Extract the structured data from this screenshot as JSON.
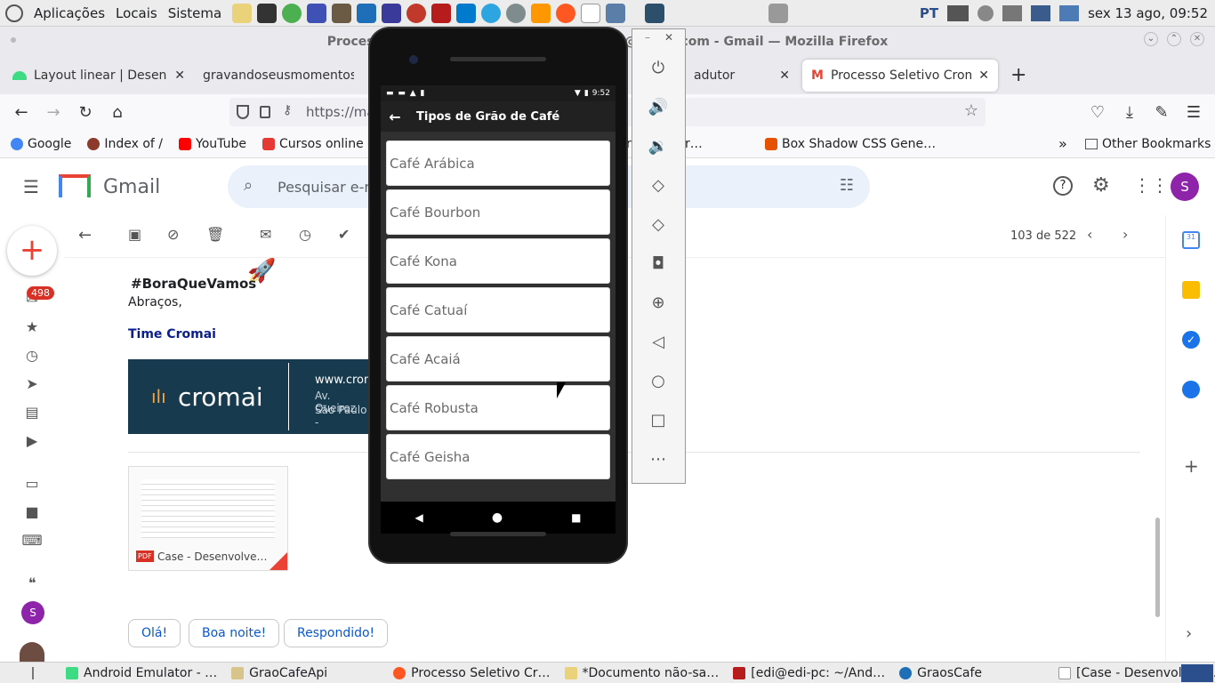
{
  "os_panel": {
    "menus": [
      "Aplicações",
      "Locais",
      "Sistema"
    ],
    "language": "PT",
    "clock": "sex 13 ago, 09:52"
  },
  "firefox": {
    "window_title": "Processo Seletivo Cromai | Pe… udinosilva@gmail.com - Gmail — Mozilla Firefox",
    "tabs": [
      {
        "label": "Layout linear  |  Desenvolv"
      },
      {
        "label": "gravandoseusmomentos.co"
      },
      {
        "label": "adutor"
      },
      {
        "label": "Processo Seletivo Cromai"
      }
    ],
    "url": "https://ma… QwBqbpmLcTshdhvrR",
    "bookmarks": [
      {
        "label": "Google"
      },
      {
        "label": "Index of /"
      },
      {
        "label": "YouTube"
      },
      {
        "label": "Cursos online - a q"
      },
      {
        "label": "re the wor…"
      },
      {
        "label": "Box Shadow CSS Gene…"
      },
      {
        "label": "Other Bookmarks"
      }
    ]
  },
  "gmail": {
    "logo_text": "Gmail",
    "search_placeholder": "Pesquisar e-m",
    "avatar_letter": "S",
    "counter": "103 de 522",
    "inbox_badge": "498",
    "body": {
      "hashtag": "#BoraQueVamos",
      "greeting": "Abraços,",
      "signature": "Time Cromai",
      "banner_brand": "cromai",
      "banner_url": "www.crom",
      "banner_addr1": "Av. Queiroz",
      "banner_addr2": "São Paulo -"
    },
    "attachment": {
      "label": "Case - Desenvolve…",
      "type": "PDF"
    },
    "smart_replies": [
      "Olá!",
      "Boa noite!",
      "Respondido!"
    ]
  },
  "emulator": {
    "status_time": "9:52",
    "app_title": "Tipos de Grão de Café",
    "items": [
      "Café Arábica",
      "Café Bourbon",
      "Café Kona",
      "Café Catuaí",
      "Café Acaiá",
      "Café Robusta",
      "Café Geisha"
    ]
  },
  "taskbar": [
    {
      "label": "Android Emulator - …"
    },
    {
      "label": "GraoCafeApi"
    },
    {
      "label": "Processo Seletivo Cr…"
    },
    {
      "label": "*Documento não-sa…"
    },
    {
      "label": "[edi@edi-pc: ~/And…"
    },
    {
      "label": "GraosCafe"
    },
    {
      "label": "[Case - Desenvolved…"
    }
  ],
  "colors": {
    "gmail_red": "#ea4335",
    "link_blue": "#0b57d0",
    "cromai_bg": "#173a4f",
    "app_bar": "#212121"
  }
}
